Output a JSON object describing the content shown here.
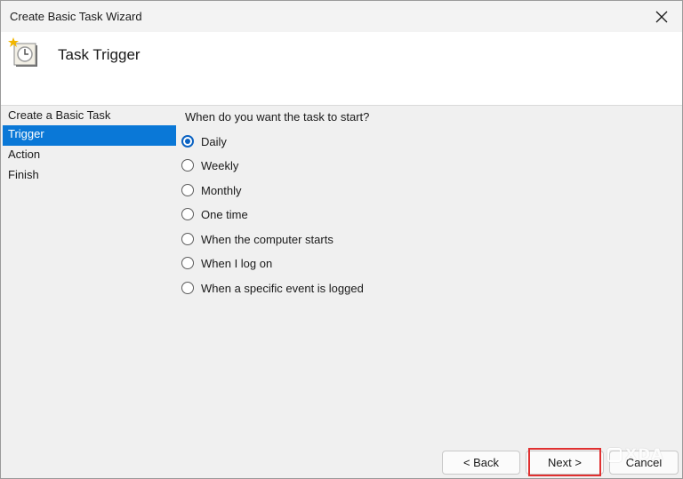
{
  "window": {
    "title": "Create Basic Task Wizard",
    "close_icon": "close-icon"
  },
  "header": {
    "icon": "task-clock-icon",
    "title": "Task Trigger"
  },
  "steps": [
    {
      "label": "Create a Basic Task",
      "active": false
    },
    {
      "label": "Trigger",
      "active": true
    },
    {
      "label": "Action",
      "active": false
    },
    {
      "label": "Finish",
      "active": false
    }
  ],
  "content": {
    "question": "When do you want the task to start?",
    "options": [
      {
        "label": "Daily",
        "checked": true
      },
      {
        "label": "Weekly",
        "checked": false
      },
      {
        "label": "Monthly",
        "checked": false
      },
      {
        "label": "One time",
        "checked": false
      },
      {
        "label": "When the computer starts",
        "checked": false
      },
      {
        "label": "When I log on",
        "checked": false
      },
      {
        "label": "When a specific event is logged",
        "checked": false
      }
    ]
  },
  "footer": {
    "back_label": "< Back",
    "next_label": "Next >",
    "cancel_label": "Cancel"
  },
  "watermark": {
    "text": "XDA"
  },
  "colors": {
    "accent": "#0a78d7",
    "highlight": "#e03030"
  }
}
